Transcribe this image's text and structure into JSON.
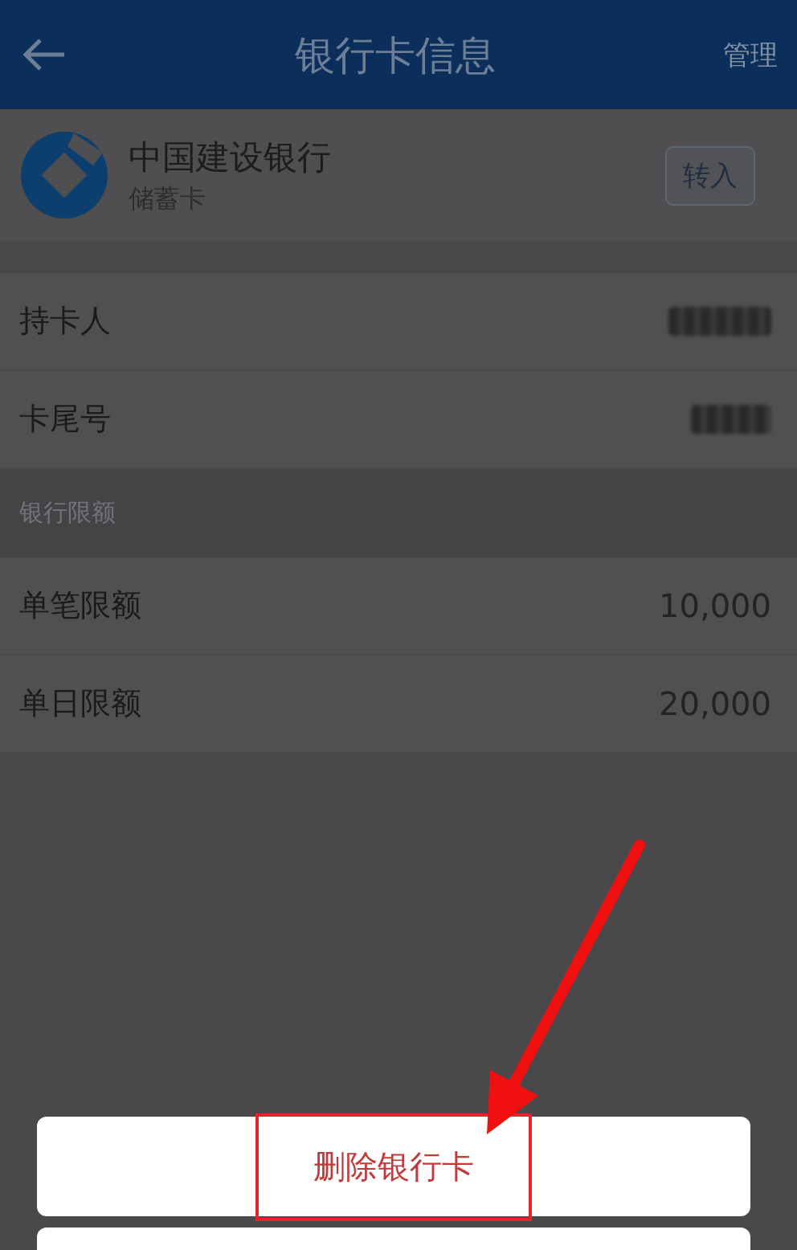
{
  "header": {
    "title": "银行卡信息",
    "action": "管理"
  },
  "bank": {
    "name": "中国建设银行",
    "card_type": "储蓄卡",
    "button": "转入"
  },
  "holder_rows": [
    {
      "label": "持卡人",
      "redacted": true
    },
    {
      "label": "卡尾号",
      "redacted": true
    }
  ],
  "limits": {
    "title": "银行限额",
    "rows": [
      {
        "label": "单笔限额",
        "value": "10,000"
      },
      {
        "label": "单日限额",
        "value": "20,000"
      }
    ]
  },
  "sheet": {
    "delete_button": "删除银行卡",
    "highlighted": true
  }
}
